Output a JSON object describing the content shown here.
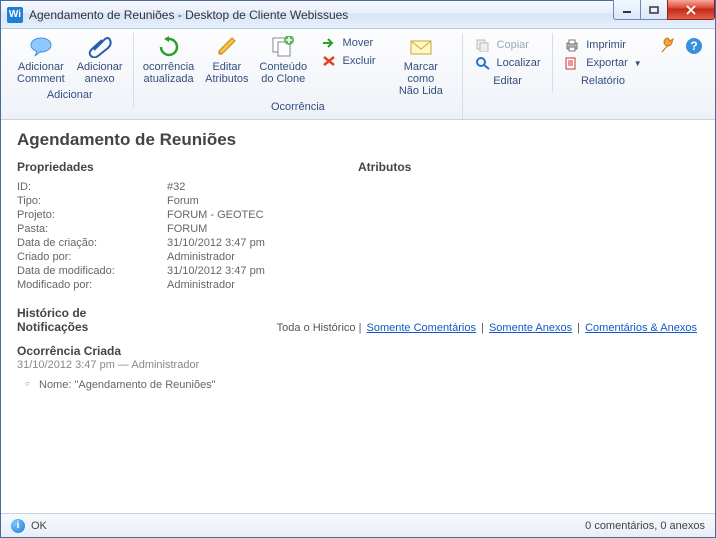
{
  "window": {
    "title": "Agendamento de Reuniões - Desktop de Cliente Webissues",
    "app_icon_text": "Wi"
  },
  "toolbar": {
    "groups": {
      "adicionar": {
        "label": "Adicionar",
        "add_comment": {
          "l1": "Adicionar",
          "l2": "Comment"
        },
        "add_anexo": {
          "l1": "Adicionar",
          "l2": "anexo"
        }
      },
      "ocorrencia": {
        "label": "Ocorrência",
        "ocorrencia_atualizada": {
          "l1": "ocorrência",
          "l2": "atualizada"
        },
        "editar_atributos": {
          "l1": "Editar",
          "l2": "Atributos"
        },
        "conteudo_clone": {
          "l1": "Conteúdo",
          "l2": "do Clone"
        },
        "mover": "Mover",
        "excluir": "Excluir",
        "marcar_naolida": {
          "l1": "Marcar como",
          "l2": "Não Lida"
        }
      },
      "editar": {
        "label": "Editar",
        "copiar": "Copiar",
        "localizar": "Localizar"
      },
      "relatorio": {
        "label": "Relatório",
        "imprimir": "Imprimir",
        "exportar": "Exportar"
      }
    }
  },
  "page": {
    "heading": "Agendamento de Reuniões",
    "propriedades_label": "Propriedades",
    "atributos_label": "Atributos",
    "properties": {
      "id_k": "ID:",
      "id_v": "#32",
      "tipo_k": "Tipo:",
      "tipo_v": "Forum",
      "projeto_k": "Projeto:",
      "projeto_v": "FORUM - GEOTEC",
      "pasta_k": "Pasta:",
      "pasta_v": "FORUM",
      "criacao_k": "Data de criação:",
      "criacao_v": "31/10/2012 3:47 pm",
      "criadopor_k": "Criado por:",
      "criadopor_v": "Administrador",
      "modificado_k": "Data de modificado:",
      "modificado_v": "31/10/2012 3:47 pm",
      "modificadopor_k": "Modificado por:",
      "modificadopor_v": "Administrador"
    },
    "historico": {
      "title_l1": "Histórico de",
      "title_l2": "Notificações",
      "filter_all": "Toda o Histórico",
      "filter_comments": "Somente Comentários",
      "filter_anexos": "Somente Anexos",
      "filter_both": "Comentários & Anexos"
    },
    "event": {
      "title": "Ocorrência Criada",
      "meta": "31/10/2012 3:47 pm — Administrador",
      "body": "Nome: \"Agendamento de Reuniões\""
    }
  },
  "status": {
    "ok": "OK",
    "right": "0 comentários, 0 anexos"
  }
}
